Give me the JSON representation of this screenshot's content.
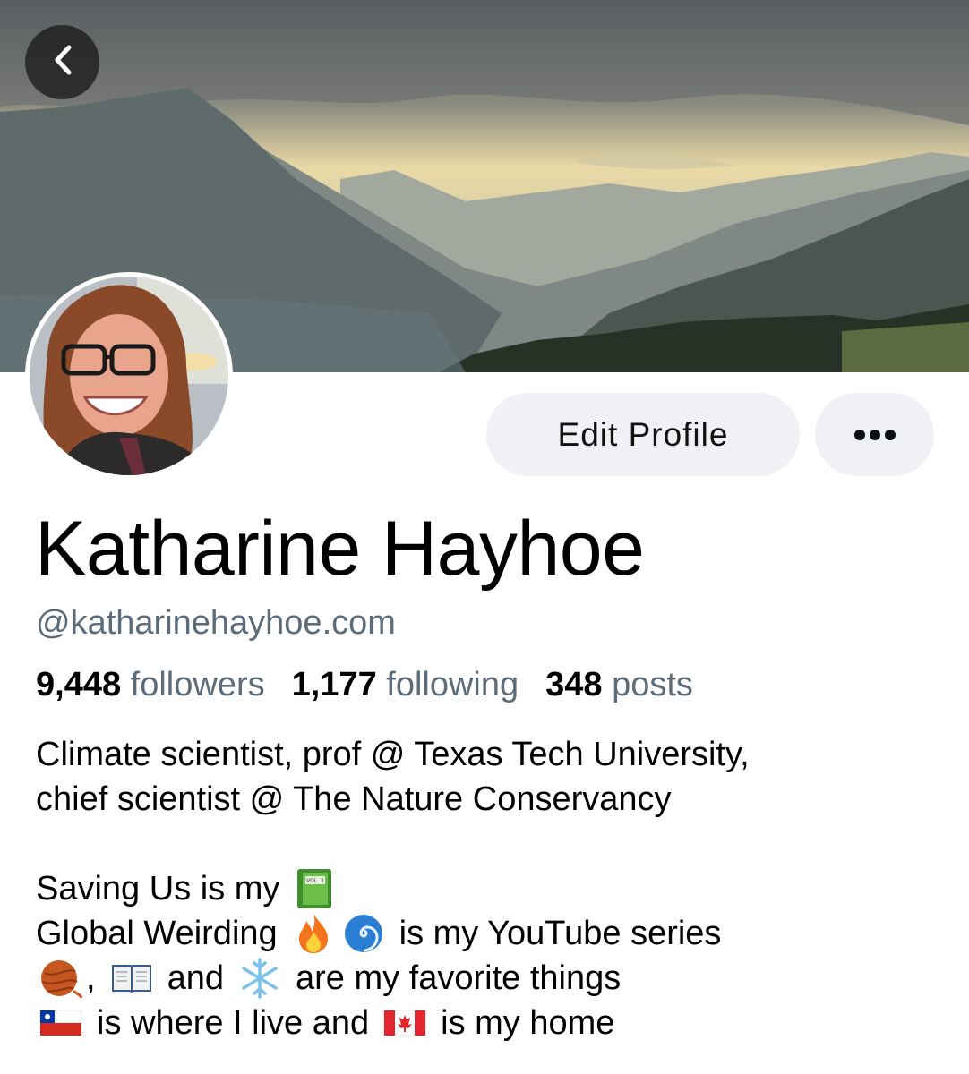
{
  "profile": {
    "display_name": "Katharine Hayhoe",
    "handle": "@katharinehayhoe.com",
    "edit_label": "Edit Profile"
  },
  "stats": {
    "followers_count": "9,448",
    "followers_label": "followers",
    "following_count": "1,177",
    "following_label": "following",
    "posts_count": "348",
    "posts_label": "posts"
  },
  "bio": {
    "line1": "Climate scientist, prof @ Texas Tech University,",
    "line2": "chief scientist @ The Nature Conservancy",
    "line3_a": "Saving Us is my",
    "line4_a": "Global Weirding",
    "line4_b": "is my YouTube series",
    "line5_a": ",",
    "line5_b": "and",
    "line5_c": "are my favorite things",
    "line6_a": "is where I live and",
    "line6_b": "is my home"
  },
  "icons": {
    "back": "chevron-left-icon",
    "more": "ellipsis-icon",
    "book_volume": "green-book-icon",
    "fire": "fire-icon",
    "cyclone": "cyclone-icon",
    "yarn": "yarn-ball-icon",
    "open_book": "open-book-icon",
    "snowflake": "snowflake-icon",
    "flag_chile": "chile-flag-icon",
    "flag_canada": "canada-flag-icon",
    "book_label": "VOL. 2"
  },
  "colors": {
    "secondary_text": "#5d6c7a",
    "button_bg": "#eff1f5"
  }
}
